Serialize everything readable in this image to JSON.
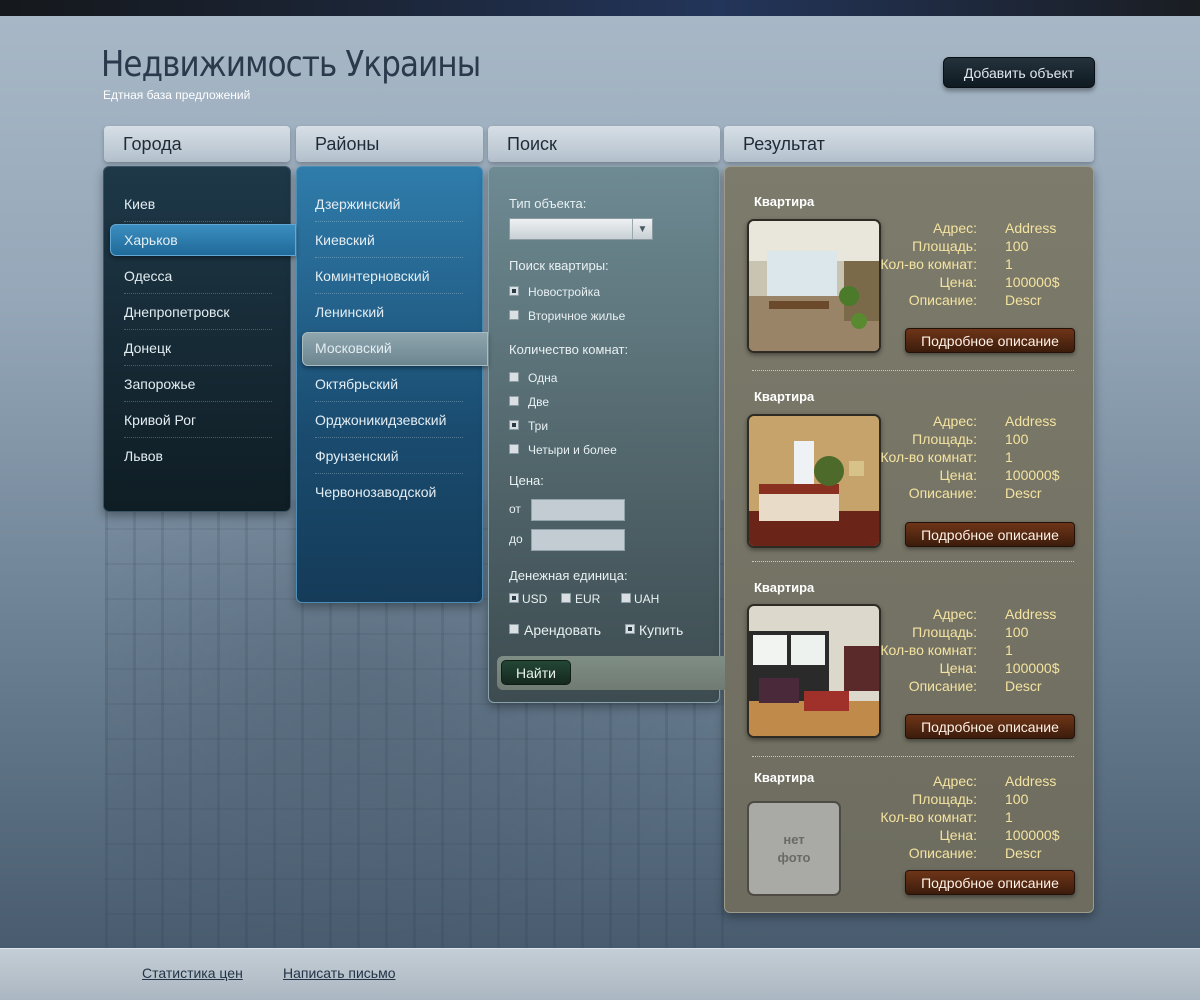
{
  "header": {
    "title": "Недвижимость Украины",
    "subtitle": "Едтная база предложений",
    "add_button": "Добавить объект"
  },
  "columns": {
    "cities": "Города",
    "districts": "Районы",
    "search": "Поиск",
    "results": "Результат"
  },
  "cities": {
    "selected": "Харьков",
    "items": [
      "Киев",
      "Харьков",
      "Одесса",
      "Днепропетровск",
      "Донецк",
      "Запорожье",
      "Кривой Рог",
      "Львов"
    ]
  },
  "districts": {
    "selected": "Московский",
    "items": [
      "Дзержинский",
      "Киевский",
      "Коминтерновский",
      "Ленинский",
      "Московский",
      "Октябрьский",
      "Орджоникидзевский",
      "Фрунзенский",
      "Червонозаводской"
    ]
  },
  "search": {
    "object_type_label": "Тип объекта:",
    "object_type_value": "",
    "apartment_search_label": "Поиск квартиры:",
    "apartment_options": [
      {
        "label": "Новостройка",
        "checked": true
      },
      {
        "label": "Вторичное жилье",
        "checked": false
      }
    ],
    "rooms_label": "Количество комнат:",
    "room_options": [
      {
        "label": "Одна",
        "checked": false
      },
      {
        "label": "Две",
        "checked": false
      },
      {
        "label": "Три",
        "checked": true
      },
      {
        "label": "Четыри и более",
        "checked": false
      }
    ],
    "price_label": "Цена:",
    "price_from_label": "от",
    "price_to_label": "до",
    "price_from_value": "",
    "price_to_value": "",
    "currency_label": "Денежная единица:",
    "currency_options": [
      {
        "label": "USD",
        "checked": true
      },
      {
        "label": "EUR",
        "checked": false
      },
      {
        "label": "UAH",
        "checked": false
      }
    ],
    "deal_options": [
      {
        "label": "Арендовать",
        "checked": false
      },
      {
        "label": "Купить",
        "checked": true
      }
    ],
    "find_button": "Найти"
  },
  "results": {
    "field_labels": {
      "address": "Адрес:",
      "area": "Площадь:",
      "rooms": "Кол-во комнат:",
      "price": "Цена:",
      "description": "Описание:"
    },
    "details_button": "Подробное описание",
    "no_photo_line1": "нет",
    "no_photo_line2": "фото",
    "items": [
      {
        "title": "Квартира",
        "address": "Address",
        "area": "100",
        "rooms": "1",
        "price": "100000$",
        "description": "Descr",
        "photo": "kitchen"
      },
      {
        "title": "Квартира",
        "address": "Address",
        "area": "100",
        "rooms": "1",
        "price": "100000$",
        "description": "Descr",
        "photo": "bedroom"
      },
      {
        "title": "Квартира",
        "address": "Address",
        "area": "100",
        "rooms": "1",
        "price": "100000$",
        "description": "Descr",
        "photo": "living-room"
      },
      {
        "title": "Квартира",
        "address": "Address",
        "area": "100",
        "rooms": "1",
        "price": "100000$",
        "description": "Descr",
        "photo": "none"
      }
    ]
  },
  "footer": {
    "links": [
      "Статистика цен",
      "Написать письмо"
    ]
  },
  "colors": {
    "cities_panel": "#12232d",
    "districts_panel": "#1f5e88",
    "search_panel": "#5e7479",
    "results_panel": "#77766a",
    "details_button": "#5a2a12",
    "result_text": "#f4e3a0"
  }
}
